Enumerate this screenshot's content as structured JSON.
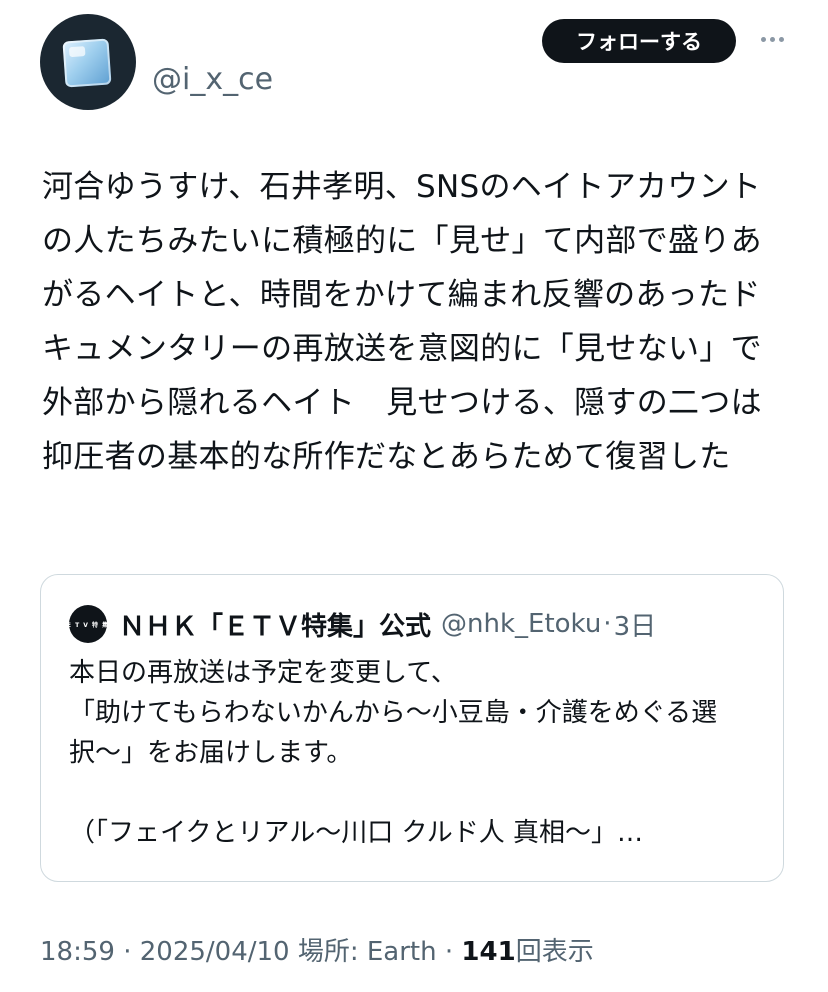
{
  "author": {
    "handle": "@i_x_ce",
    "avatar_icon": "ice-cube-icon"
  },
  "header": {
    "follow_label": "フォローする",
    "more_icon": "more-icon"
  },
  "post": {
    "text": "河合ゆうすけ、石井孝明、SNSのヘイトアカウントの人たちみたいに積極的に「見せ」て内部で盛りあがるヘイトと、時間をかけて編まれ反響のあったドキュメンタリーの再放送を意図的に「見せない」で外部から隠れるヘイト　見せつける、隠すの二つは抑圧者の基本的な所作だなとあらためて復習した"
  },
  "quote": {
    "avatar_text": "ETV特集",
    "name": "ＮＨＫ「ＥＴＶ特集」公式",
    "handle": "@nhk_Etoku",
    "separator": "·",
    "time": "3日",
    "text": "本日の再放送は予定を変更して、\n「助けてもらわないかんから〜小豆島・介護をめぐる選択〜」をお届けします。\n\n（「フェイクとリアル〜川口 クルド人 真相〜」…"
  },
  "meta": {
    "time": "18:59",
    "sep1": " · ",
    "date": "2025/04/10",
    "location": " 場所: Earth",
    "sep2": " · ",
    "views_count": "141",
    "views_label": "回表示"
  },
  "colors": {
    "text": "#0f1419",
    "secondary": "#536471",
    "border": "#cfd9de",
    "button_bg": "#0f1419"
  }
}
